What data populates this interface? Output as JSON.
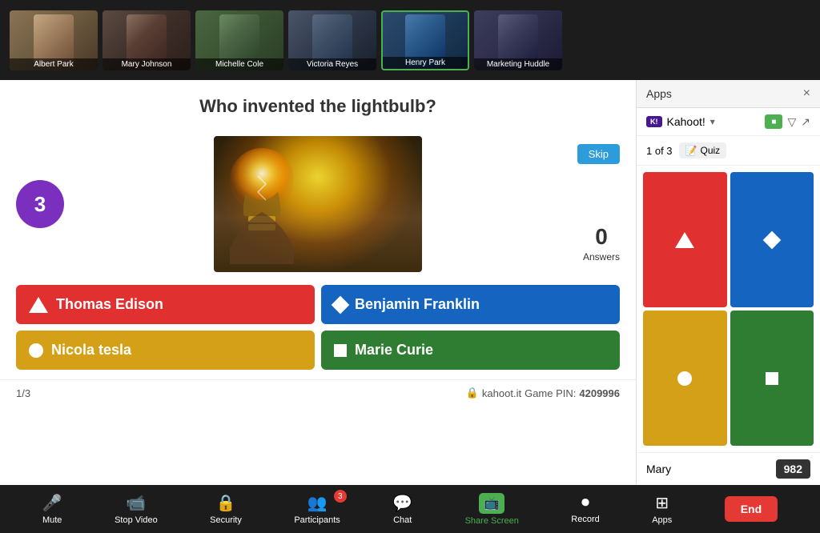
{
  "window": {
    "title": "Apps",
    "close_label": "×"
  },
  "video_bar": {
    "participants": [
      {
        "id": "albert",
        "name": "Albert Park",
        "thumb_class": "thumb-albert",
        "active": false
      },
      {
        "id": "mary",
        "name": "Mary Johnson",
        "thumb_class": "thumb-mary",
        "active": false
      },
      {
        "id": "michelle",
        "name": "Michelle Cole",
        "thumb_class": "thumb-michelle",
        "active": false
      },
      {
        "id": "victoria",
        "name": "Victoria Reyes",
        "thumb_class": "thumb-victoria",
        "active": false
      },
      {
        "id": "henry",
        "name": "Henry Park",
        "thumb_class": "thumb-henry",
        "active": true
      },
      {
        "id": "marketing",
        "name": "Marketing Huddle",
        "thumb_class": "thumb-marketing",
        "active": false
      }
    ]
  },
  "game": {
    "question": "Who invented the lightbulb?",
    "timer": "3",
    "skip_label": "Skip",
    "answers_count": "0",
    "answers_label": "Answers",
    "page": "1/3",
    "kahoot_url": "kahoot.it",
    "game_pin_label": "Game PIN:",
    "game_pin": "4209996",
    "answers": [
      {
        "id": "a1",
        "text": "Thomas Edison",
        "color": "answer-red",
        "icon": "triangle"
      },
      {
        "id": "a2",
        "text": "Benjamin Franklin",
        "color": "answer-blue",
        "icon": "diamond"
      },
      {
        "id": "a3",
        "text": "Nicola tesla",
        "color": "answer-yellow",
        "icon": "circle"
      },
      {
        "id": "a4",
        "text": "Marie Curie",
        "color": "answer-green",
        "icon": "square"
      }
    ]
  },
  "toolbar": {
    "items": [
      {
        "id": "mute",
        "label": "Mute",
        "icon": "🎤",
        "active": false
      },
      {
        "id": "stop-video",
        "label": "Stop Video",
        "icon": "📹",
        "active": false
      },
      {
        "id": "security",
        "label": "Security",
        "icon": "🔒",
        "active": false
      },
      {
        "id": "participants",
        "label": "Participants",
        "icon": "👥",
        "badge": "3",
        "active": false
      },
      {
        "id": "chat",
        "label": "Chat",
        "icon": "💬",
        "active": false
      },
      {
        "id": "share-screen",
        "label": "Share Screen",
        "icon": "📺",
        "active": true
      },
      {
        "id": "record",
        "label": "Record",
        "icon": "⏺",
        "active": false
      },
      {
        "id": "apps",
        "label": "Apps",
        "icon": "⊞",
        "active": false
      }
    ],
    "end_label": "End"
  },
  "apps_panel": {
    "title": "Apps",
    "kahoot": {
      "logo": "K!",
      "name": "Kahoot!",
      "quiz_counter": "1 of 3",
      "quiz_label": "Quiz"
    },
    "cells": [
      {
        "id": "red",
        "color": "cell-red",
        "shape": "triangle"
      },
      {
        "id": "blue",
        "color": "cell-blue",
        "shape": "diamond"
      },
      {
        "id": "yellow",
        "color": "cell-yellow",
        "shape": "circle"
      },
      {
        "id": "green",
        "color": "cell-green",
        "shape": "square"
      }
    ],
    "player": {
      "name": "Mary",
      "score": "982"
    }
  }
}
